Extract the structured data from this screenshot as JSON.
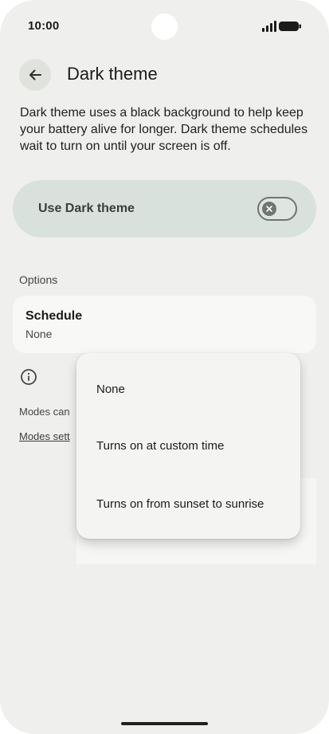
{
  "status_bar": {
    "time": "10:00",
    "icons": [
      "signal-icon",
      "battery-icon"
    ]
  },
  "header": {
    "back_icon": "arrow-left-icon",
    "title": "Dark theme"
  },
  "description": "Dark theme uses a black background to help keep your battery alive for longer. Dark theme schedules wait to turn on until your screen is off.",
  "use_dark_theme": {
    "label": "Use Dark theme",
    "enabled": false
  },
  "options": {
    "header": "Options",
    "schedule": {
      "title": "Schedule",
      "value": "None"
    },
    "info_icon": "info-icon",
    "modes_text": "Modes can",
    "modes_link": "Modes sett"
  },
  "schedule_menu": {
    "items": [
      "None",
      "Turns on at custom time",
      "Turns on from sunset to sunrise"
    ]
  },
  "colors": {
    "background": "#efefed",
    "toggle_card": "#d8e1dc",
    "card": "#f8f8f6",
    "menu": "#f4f4f2"
  }
}
